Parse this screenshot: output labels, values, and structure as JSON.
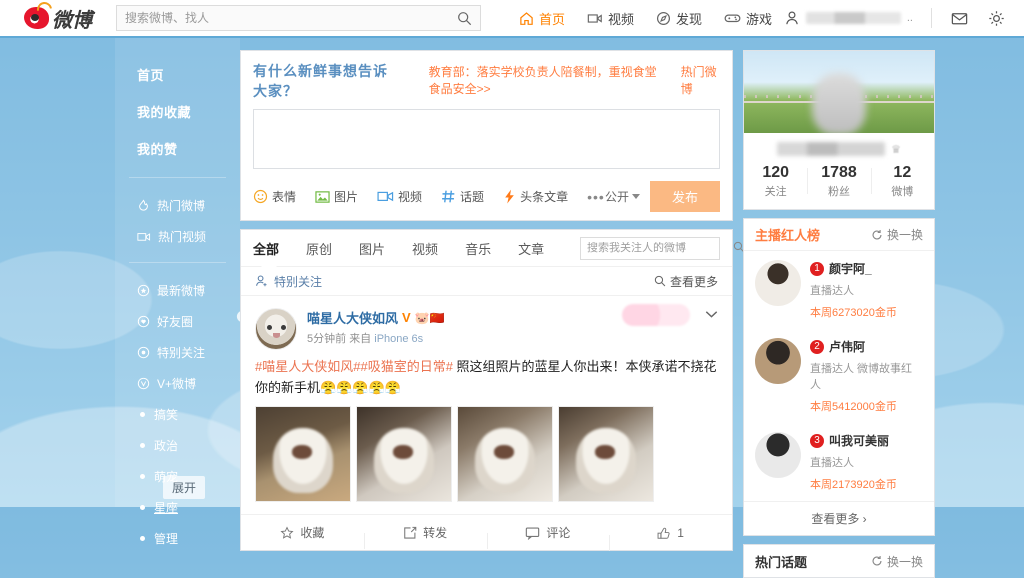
{
  "topbar": {
    "logo_text": "微博",
    "search": {
      "placeholder": "搜索微博、找人",
      "value": "",
      "icon": "search-icon"
    },
    "nav": [
      {
        "label": "首页",
        "icon": "home-icon",
        "active": true
      },
      {
        "label": "视频",
        "icon": "video-icon",
        "active": false
      },
      {
        "label": "发现",
        "icon": "compass-icon",
        "active": false
      },
      {
        "label": "游戏",
        "icon": "game-icon",
        "active": false
      }
    ],
    "user": {
      "icon": "person-icon",
      "name_blurred": true,
      "ellipsis": ".."
    },
    "mail_icon": "mail-icon",
    "settings_icon": "gear-icon",
    "active_color": "#ff8200"
  },
  "sidebar": {
    "top_items": [
      {
        "label": "首页"
      },
      {
        "label": "我的收藏"
      },
      {
        "label": "我的赞"
      }
    ],
    "group1": [
      {
        "label": "热门微博",
        "icon": "flame-icon"
      },
      {
        "label": "热门视频",
        "icon": "video-icon"
      }
    ],
    "group2": [
      {
        "label": "最新微博",
        "icon": "star-circle-icon"
      },
      {
        "label": "好友圈",
        "icon": "heart-circle-icon"
      },
      {
        "label": "特别关注",
        "icon": "target-circle-icon"
      },
      {
        "label": "V+微博",
        "icon": "v-circle-icon"
      }
    ],
    "groups": [
      {
        "label": "搞笑",
        "icon": "dot-icon"
      },
      {
        "label": "政治",
        "icon": "dot-icon"
      },
      {
        "label": "萌宠",
        "icon": "dot-icon"
      },
      {
        "label": "星座",
        "icon": "dot-icon",
        "underline": true
      },
      {
        "label": "管理",
        "icon": "dot-icon"
      }
    ],
    "gear_icon": "gear-icon",
    "expand_label": "展开"
  },
  "compose": {
    "title": "有什么新鲜事想告诉大家？",
    "news": "教育部：落实学校负责人陪餐制，重视食堂食品安全>>",
    "hot_link": "热门微博",
    "textarea_value": "",
    "tools": [
      {
        "label": "表情",
        "icon": "smiley-icon"
      },
      {
        "label": "图片",
        "icon": "image-icon"
      },
      {
        "label": "视频",
        "icon": "video-icon"
      },
      {
        "label": "话题",
        "icon": "hash-icon"
      },
      {
        "label": "头条文章",
        "icon": "lightning-icon"
      }
    ],
    "more_label": "•••",
    "privacy_label": "公开",
    "publish_label": "发布",
    "publish_color": "#fbb983"
  },
  "feed": {
    "tabs": [
      {
        "label": "全部",
        "active": true
      },
      {
        "label": "原创",
        "active": false
      },
      {
        "label": "图片",
        "active": false
      },
      {
        "label": "视频",
        "active": false
      },
      {
        "label": "音乐",
        "active": false
      },
      {
        "label": "文章",
        "active": false
      }
    ],
    "search": {
      "placeholder": "搜索我关注人的微博",
      "value": "",
      "icon": "search-icon"
    },
    "special_label": "特别关注",
    "special_icon": "person-add-icon",
    "see_more_label": "查看更多",
    "see_more_icon": "search-icon"
  },
  "post": {
    "author": "喵星人大侠如风",
    "verified_badge": "V",
    "emojis": "🐷🇨🇳",
    "time": "5分钟前",
    "source_prefix": "来自",
    "source": "iPhone 6s",
    "tags": "#喵星人大侠如风##吸猫室的日常#",
    "text": " 照这组照片的蓝星人你出来！本侠承诺不挠花你的新手机",
    "text_emojis": "😤😤😤😤😤",
    "images_count": 4,
    "chevron_icon": "chevron-down-icon",
    "actions": [
      {
        "label": "收藏",
        "icon": "star-icon",
        "count": ""
      },
      {
        "label": "转发",
        "icon": "share-icon",
        "count": ""
      },
      {
        "label": "评论",
        "icon": "comment-icon",
        "count": ""
      },
      {
        "label": "",
        "icon": "thumbs-up-icon",
        "count": "1"
      }
    ]
  },
  "profile": {
    "stats": [
      {
        "value": "120",
        "label": "关注"
      },
      {
        "value": "1788",
        "label": "粉丝"
      },
      {
        "value": "12",
        "label": "微博"
      }
    ]
  },
  "rank": {
    "title": "主播红人榜",
    "refresh_label": "换一换",
    "refresh_icon": "refresh-icon",
    "items": [
      {
        "num": "1",
        "name": "颜宇阿_",
        "tag": "直播达人",
        "coin": "本周6273020金币"
      },
      {
        "num": "2",
        "name": "卢伟阿",
        "tag": "直播达人 微博故事红人",
        "coin": "本周5412000金币"
      },
      {
        "num": "3",
        "name": "叫我可美丽",
        "tag": "直播达人",
        "coin": "本周2173920金币"
      }
    ],
    "more_label": "查看更多 ›"
  },
  "topics": {
    "title": "热门话题",
    "refresh_label": "换一换",
    "refresh_icon": "refresh-icon"
  }
}
